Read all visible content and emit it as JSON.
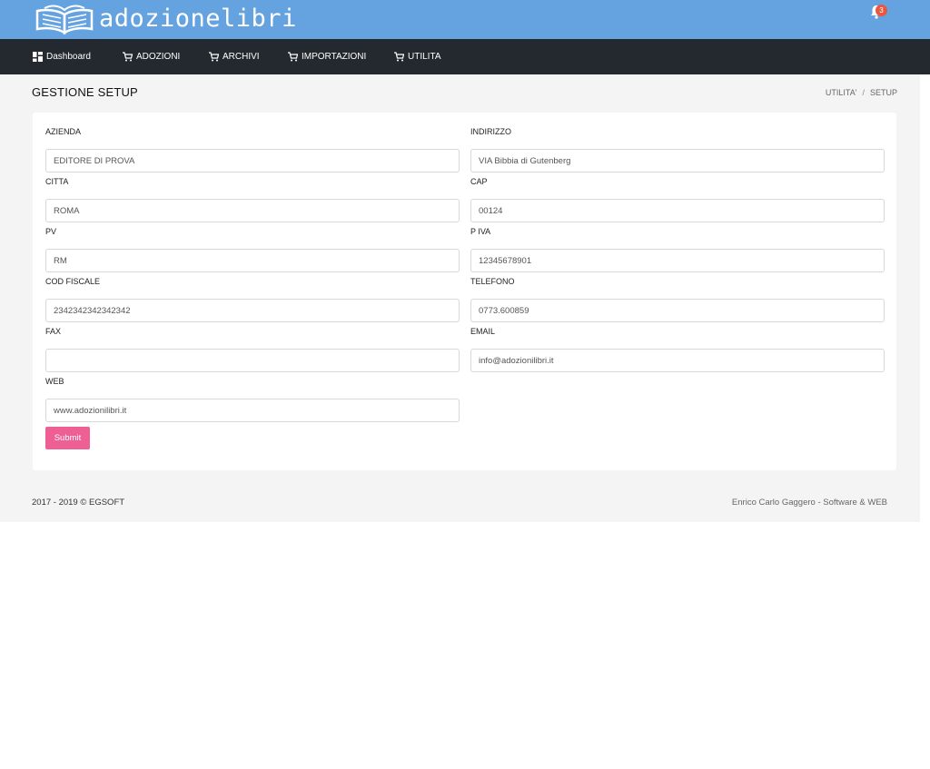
{
  "app": {
    "brand": "adozionelibri",
    "notifications_count": "3"
  },
  "nav": {
    "items": [
      {
        "label": "Dashboard",
        "icon": "dashboard-icon"
      },
      {
        "label": "ADOZIONI",
        "icon": "cart-icon"
      },
      {
        "label": "ARCHIVI",
        "icon": "cart-icon"
      },
      {
        "label": "IMPORTAZIONI",
        "icon": "cart-icon"
      },
      {
        "label": "UTILITA",
        "icon": "cart-icon"
      }
    ]
  },
  "page": {
    "title": "GESTIONE SETUP"
  },
  "breadcrumb": {
    "items": [
      "UTILITA'",
      "SETUP"
    ],
    "separator": "/"
  },
  "form": {
    "azienda": {
      "label": "AZIENDA",
      "value": "EDITORE DI PROVA"
    },
    "indirizzo": {
      "label": "INDIRIZZO",
      "value": "VIA Bibbia di Gutenberg"
    },
    "citta": {
      "label": "CITTA",
      "value": "ROMA"
    },
    "cap": {
      "label": "CAP",
      "value": "00124"
    },
    "pv": {
      "label": "PV",
      "value": "RM"
    },
    "piva": {
      "label": "P IVA",
      "value": "12345678901"
    },
    "codfiscale": {
      "label": "COD FISCALE",
      "value": "2342342342342342"
    },
    "telefono": {
      "label": "TELEFONO",
      "value": "0773.600859"
    },
    "fax": {
      "label": "FAX",
      "value": ""
    },
    "email": {
      "label": "EMAIL",
      "value": "info@adozionilibri.it"
    },
    "web": {
      "label": "WEB",
      "value": "www.adozionilibri.it"
    },
    "submit_label": "Submit"
  },
  "footer": {
    "left": "2017 - 2019 © EGSOFT",
    "right": "Enrico Carlo Gaggero - Software & WEB"
  },
  "colors": {
    "topbar": "#65a2e0",
    "navbar": "#23292e",
    "accent": "#ee5f94",
    "badge": "#e9573f"
  }
}
